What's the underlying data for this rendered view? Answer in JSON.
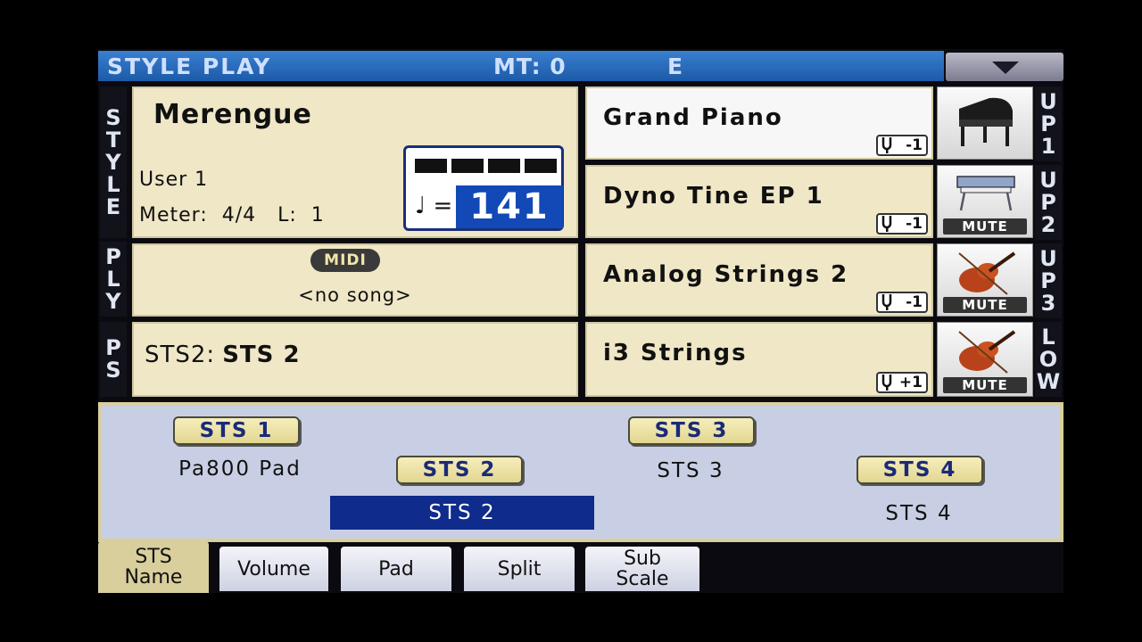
{
  "header": {
    "title": "STYLE PLAY",
    "mt": "MT: 0",
    "key": "E",
    "menu_icon": "chevron-down-icon"
  },
  "side_labels": {
    "style": [
      "S",
      "T",
      "Y",
      "L",
      "E"
    ],
    "ply": [
      "P",
      "L",
      "Y"
    ],
    "ps": [
      "P",
      "S"
    ],
    "up1": [
      "U",
      "P",
      "1"
    ],
    "up2": [
      "U",
      "P",
      "2"
    ],
    "up3": [
      "U",
      "P",
      "3"
    ],
    "low": [
      "L",
      "O",
      "W"
    ]
  },
  "style": {
    "name": "Merengue",
    "bank": "User 1",
    "meter": "Meter:  4/4   L:  1",
    "tempo_symbol": "♩ =",
    "tempo": "141"
  },
  "player": {
    "badge": "MIDI",
    "song": "<no song>"
  },
  "ps": {
    "prefix": "STS2:",
    "name": "STS 2"
  },
  "tracks": [
    {
      "name": "Grand Piano",
      "octave": "-1",
      "icon": "grand-piano-icon",
      "mute": ""
    },
    {
      "name": "Dyno Tine EP 1",
      "octave": "-1",
      "icon": "electric-piano-icon",
      "mute": "MUTE"
    },
    {
      "name": "Analog Strings 2",
      "octave": "-1",
      "icon": "violin-icon",
      "mute": "MUTE"
    },
    {
      "name": "i3 Strings",
      "octave": "+1",
      "icon": "violin-icon",
      "mute": "MUTE"
    }
  ],
  "sts": {
    "buttons": [
      "STS 1",
      "STS 2",
      "STS 3",
      "STS 4"
    ],
    "names": [
      "Pa800 Pad",
      "STS 2",
      "STS 3",
      "STS 4"
    ],
    "selected": "STS 2"
  },
  "tabs": [
    {
      "line1": "STS",
      "line2": "Name",
      "active": true
    },
    {
      "line1": "Volume",
      "line2": ""
    },
    {
      "line1": "Pad",
      "line2": ""
    },
    {
      "line1": "Split",
      "line2": ""
    },
    {
      "line1": "Sub",
      "line2": "Scale"
    }
  ]
}
